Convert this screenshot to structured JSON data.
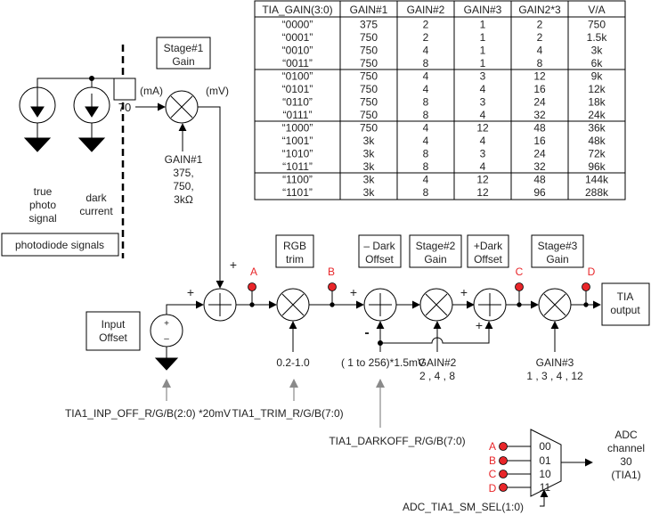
{
  "gain_table": {
    "headers": [
      "TIA_GAIN(3:0)",
      "GAIN#1",
      "GAIN#2",
      "GAIN#3",
      "GAIN2*3",
      "V/A"
    ],
    "rows": [
      [
        "“0000”",
        "375",
        "2",
        "1",
        "2",
        "750"
      ],
      [
        "“0001”",
        "750",
        "2",
        "1",
        "2",
        "1.5k"
      ],
      [
        "“0010”",
        "750",
        "4",
        "1",
        "4",
        "3k"
      ],
      [
        "“0011”",
        "750",
        "8",
        "1",
        "8",
        "6k"
      ],
      [
        "“0100”",
        "750",
        "4",
        "3",
        "12",
        "9k"
      ],
      [
        "“0101”",
        "750",
        "4",
        "4",
        "16",
        "12k"
      ],
      [
        "“0110”",
        "750",
        "8",
        "3",
        "24",
        "18k"
      ],
      [
        "“0111”",
        "750",
        "8",
        "4",
        "32",
        "24k"
      ],
      [
        "“1000”",
        "750",
        "4",
        "12",
        "48",
        "36k"
      ],
      [
        "“1001”",
        "3k",
        "4",
        "4",
        "16",
        "48k"
      ],
      [
        "“1010”",
        "3k",
        "8",
        "3",
        "24",
        "72k"
      ],
      [
        "“1011”",
        "3k",
        "8",
        "4",
        "32",
        "96k"
      ],
      [
        "“1100”",
        "3k",
        "4",
        "12",
        "48",
        "144k"
      ],
      [
        "“1101”",
        "3k",
        "8",
        "12",
        "96",
        "288k"
      ]
    ]
  },
  "photodiode": {
    "true_signal": [
      "true",
      "photo",
      "signal"
    ],
    "dark_current": [
      "dark",
      "current"
    ],
    "label": "photodiode signals",
    "pin": "70",
    "unit_in": "(mA)",
    "unit_out": "(mV)"
  },
  "stage1": {
    "title": [
      "Stage#1",
      "Gain"
    ],
    "gain": [
      "GAIN#1",
      "375,",
      "750,",
      "3kΩ"
    ]
  },
  "input_offset": {
    "title": [
      "Input",
      "Offset"
    ],
    "register": "TIA1_INP_OFF_R/G/B(2:0) *20mV",
    "plus": "+",
    "minus": "–"
  },
  "rgb_trim": {
    "title": [
      "RGB",
      "trim"
    ],
    "range": "0.2-1.0",
    "register": "TIA1_TRIM_R/G/B(7:0)"
  },
  "dark_offset_sub": {
    "title": [
      "– Dark",
      "Offset"
    ],
    "range": "( 1 to 256)*1.5mV",
    "register": "TIA1_DARKOFF_R/G/B(7:0)"
  },
  "stage2": {
    "title": [
      "Stage#2",
      "Gain"
    ],
    "gain": [
      "GAIN#2",
      "2 , 4 , 8"
    ]
  },
  "dark_offset_add": {
    "title": [
      "+Dark",
      "Offset"
    ]
  },
  "stage3": {
    "title": [
      "Stage#3",
      "Gain"
    ],
    "gain": [
      "GAIN#3",
      "1 , 3 , 4 , 12"
    ]
  },
  "tia_output": [
    "TIA",
    "output"
  ],
  "test_points": [
    "A",
    "B",
    "C",
    "D"
  ],
  "signs": {
    "plus": "+",
    "minus": "-"
  },
  "mux": {
    "inputs": [
      "A",
      "B",
      "C",
      "D"
    ],
    "codes": [
      "00",
      "01",
      "10",
      "11"
    ],
    "select": "ADC_TIA1_SM_SEL(1:0)",
    "output": [
      "ADC",
      "channel",
      "30",
      "(TIA1)"
    ]
  },
  "colors": {
    "test_point": "#e8262a",
    "register_arrow": "#8a8a8a",
    "line": "#000000"
  }
}
